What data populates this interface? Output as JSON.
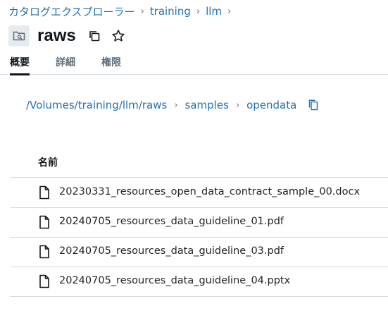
{
  "breadcrumb": {
    "items": [
      "カタログエクスプローラー",
      "training",
      "llm"
    ],
    "trailing_separator": "›"
  },
  "header": {
    "title": "raws",
    "folder_icon": "folder-icon",
    "copy_icon": "copy-icon",
    "star_icon": "star-icon"
  },
  "tabs": [
    {
      "label": "概要",
      "active": true
    },
    {
      "label": "詳細",
      "active": false
    },
    {
      "label": "権限",
      "active": false
    }
  ],
  "path": {
    "segments": [
      "/Volumes/training/llm/raws",
      "samples",
      "opendata"
    ],
    "separator": "›",
    "copy_icon": "copy-icon"
  },
  "table": {
    "column_name": "名前",
    "rows": [
      {
        "name": "20230331_resources_open_data_contract_sample_00.docx",
        "icon": "file-icon"
      },
      {
        "name": "20240705_resources_data_guideline_01.pdf",
        "icon": "file-icon"
      },
      {
        "name": "20240705_resources_data_guideline_03.pdf",
        "icon": "file-icon"
      },
      {
        "name": "20240705_resources_data_guideline_04.pptx",
        "icon": "file-icon"
      }
    ]
  },
  "colors": {
    "link": "#2272b4",
    "text": "#11171c",
    "border": "#d1d9e1"
  }
}
